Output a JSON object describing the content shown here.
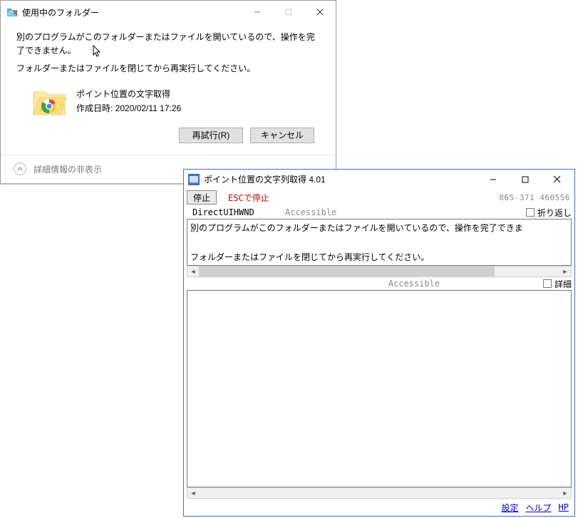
{
  "dialog": {
    "title": "使用中のフォルダー",
    "message1": "別のプログラムがこのフォルダーまたはファイルを開いているので、操作を完了できません。",
    "message2": "フォルダーまたはファイルを閉じてから再実行してください。",
    "item_name": "ポイント位置の文字取得",
    "item_date_label": "作成日時: 2020/02/11 17:26",
    "retry": "再試行(R)",
    "cancel": "キャンセル",
    "footer_link": "詳細情報の非表示"
  },
  "tool": {
    "title": "ポイント位置の文字列取得 4.01",
    "stop": "停止",
    "esc_label": "ESCで停止",
    "coords": "865-371  460556",
    "class_name": "DirectUIHWND",
    "api1": "Accessible",
    "wrap_label": "折り返し",
    "captured_text": "別のプログラムがこのフォルダーまたはファイルを開いているので、操作を完了できま\n\nフォルダーまたはファイルを閉じてから再実行してください。",
    "api2": "Accessible",
    "detail_label": "詳細",
    "link_settings": "設定",
    "link_help": "ヘルプ",
    "link_hp": "HP"
  }
}
